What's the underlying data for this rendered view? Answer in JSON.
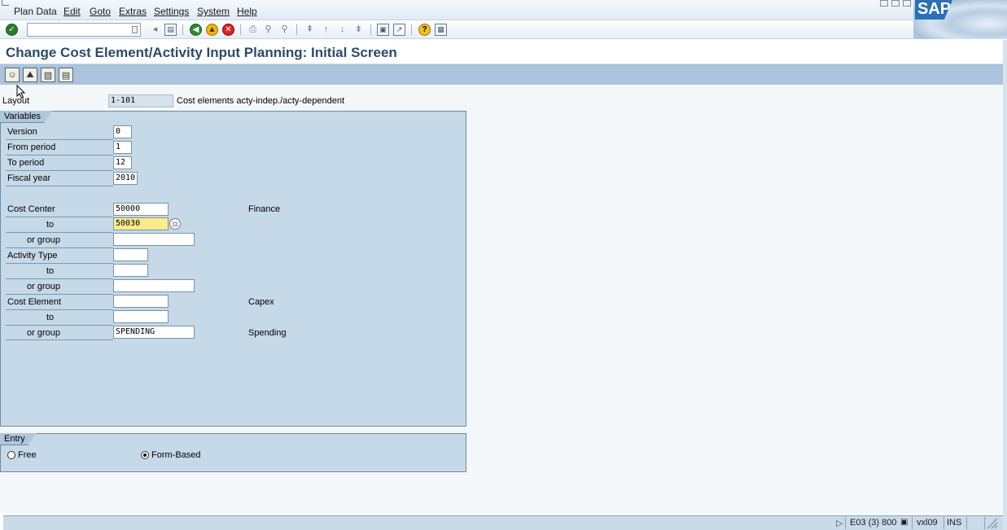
{
  "menu": {
    "items": [
      "Plan Data",
      "Edit",
      "Goto",
      "Extras",
      "Settings",
      "System",
      "Help"
    ]
  },
  "toolbar": {
    "command_value": "",
    "icons": [
      "enter-icon",
      "back-icon",
      "exit-icon",
      "cancel-icon",
      "save-icon",
      "print-icon",
      "find-icon",
      "find-next-icon",
      "first-page-icon",
      "previous-page-icon",
      "next-page-icon",
      "last-page-icon",
      "create-session-icon",
      "shortcut-icon",
      "help-icon",
      "customize-layout-icon"
    ]
  },
  "sap_logo": "SAP",
  "title": "Change Cost Element/Activity Input Planning: Initial Screen",
  "app_toolbar": {
    "icons": [
      "person-icon",
      "overview-icon",
      "detail-icon",
      "document-icon"
    ]
  },
  "layout": {
    "label": "Layout",
    "value": "1-101",
    "description": "Cost elements acty-indep./acty-dependent"
  },
  "variables": {
    "title": "Variables",
    "version_label": "Version",
    "version_value": "0",
    "from_period_label": "From period",
    "from_period_value": "1",
    "to_period_label": "To period",
    "to_period_value": "12",
    "fiscal_year_label": "Fiscal year",
    "fiscal_year_value": "2010",
    "cost_center_label": "Cost Center",
    "cost_center_from": "50000",
    "cost_center_desc": "Finance",
    "cost_center_to_label": "to",
    "cost_center_to": "50030",
    "cost_center_group_label": "or group",
    "cost_center_group": "",
    "activity_type_label": "Activity Type",
    "activity_type_from": "",
    "activity_type_to_label": "to",
    "activity_type_to": "",
    "activity_type_group_label": "or group",
    "activity_type_group": "",
    "cost_element_label": "Cost Element",
    "cost_element_from": "",
    "cost_element_desc": "Capex",
    "cost_element_to_label": "to",
    "cost_element_to": "",
    "cost_element_group_label": "or group",
    "cost_element_group": "SPENDING",
    "cost_element_group_desc": "Spending"
  },
  "entry": {
    "title": "Entry",
    "free_label": "Free",
    "free_selected": false,
    "form_based_label": "Form-Based",
    "form_based_selected": true
  },
  "status": {
    "system": "E03 (3) 800",
    "server": "vxl09",
    "mode": "INS"
  },
  "colors": {
    "title": "#2c4a6b",
    "group_bg": "#c6d9e8",
    "app_toolbar": "#a9c4dc",
    "focused_field": "#fdeb8c"
  }
}
